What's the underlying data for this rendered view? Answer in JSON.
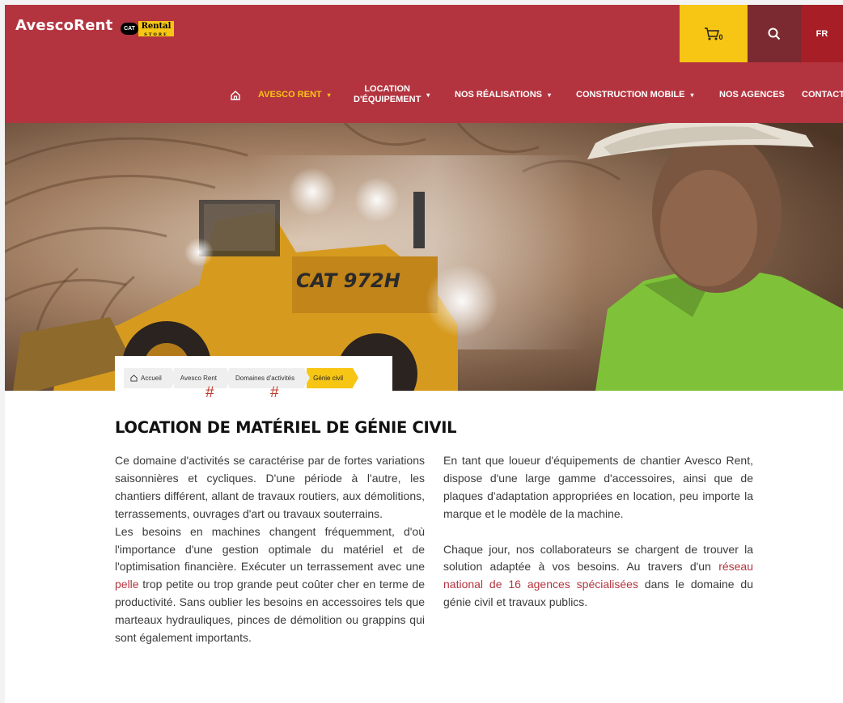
{
  "header": {
    "logo_text": "AvescoRent",
    "badge_cat": "CAT",
    "badge_rental": "Rental",
    "badge_rental_sub": "STORE",
    "cart_count": "0",
    "lang": "FR",
    "brand_color": "#b3343f",
    "accent_color": "#f7c514"
  },
  "nav": {
    "items": [
      {
        "label": "Avesco Rent",
        "active": true,
        "dropdown": true
      },
      {
        "label": "Location",
        "label2": "d'Équipement",
        "dropdown": true
      },
      {
        "label": "Nos Réalisations",
        "dropdown": true
      },
      {
        "label": "Construction Mobile",
        "dropdown": true
      },
      {
        "label": "Nos Agences"
      },
      {
        "label": "Contact"
      }
    ],
    "caret": "▾"
  },
  "breadcrumb": {
    "items": [
      "Accueil",
      "Avesco Rent",
      "Domaines d'activités",
      "Génie civil"
    ],
    "hash": "#"
  },
  "content": {
    "title": "LOCATION DE MATÉRIEL DE GÉNIE CIVIL",
    "left": {
      "p1": "Ce domaine d'activités se caractérise par de fortes variations saisonnières et cycliques. D'une période à l'autre, les chantiers différent, allant de travaux routiers, aux démolitions, terrassements, ouvrages d'art ou travaux souterrains.",
      "p2_before": "Les besoins en machines changent fréquemment, d'où l'importance d'une gestion optimale du matériel et de l'optimisation financière. Exécuter un terrassement avec une ",
      "p2_link": "pelle",
      "p2_after": " trop petite ou trop grande peut coûter cher en terme de productivité. Sans oublier les besoins en accessoires tels que marteaux hydrauliques, pinces de démolition ou grappins qui sont également importants."
    },
    "right": {
      "p1": "En tant que loueur d'équipements de chantier Avesco Rent, dispose d'une large gamme d'accessoires, ainsi que de plaques d'adaptation appropriées en location, peu importe la marque et le modèle de la machine.",
      "p2_before": "Chaque jour, nos collaborateurs se chargent de trouver la solution adaptée à vos besoins. Au travers d'un ",
      "p2_link": "réseau national de 16 agences spécialisées",
      "p2_after": " dans le domaine du génie civil et travaux publics."
    }
  },
  "hero": {
    "machine_text": "CAT 972H"
  },
  "icons": [
    "home-icon",
    "cart-icon",
    "search-icon"
  ]
}
